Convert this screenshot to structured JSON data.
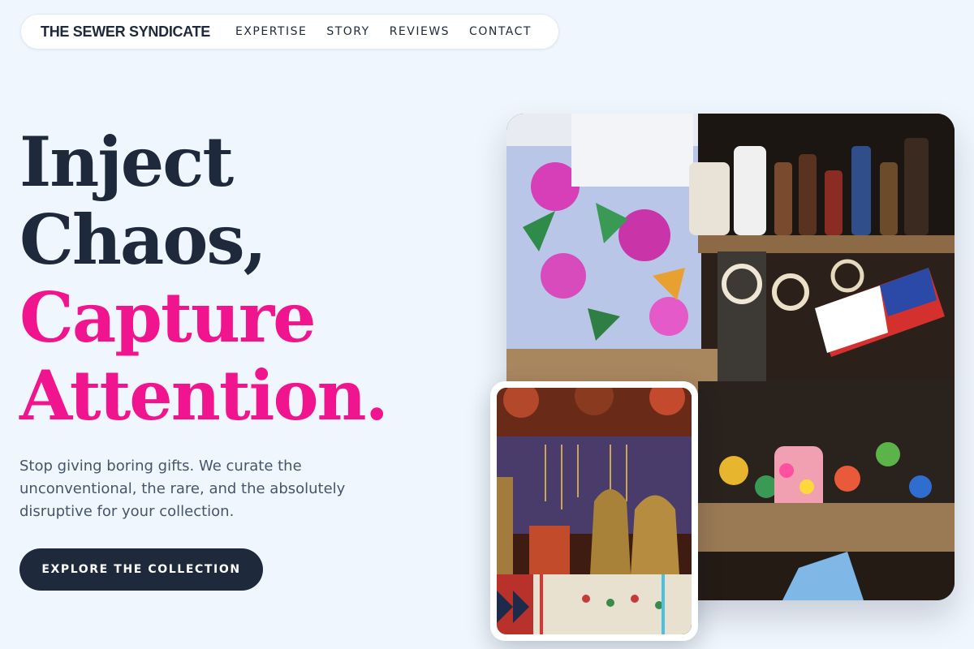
{
  "brand": "THE SEWER SYNDICATE",
  "nav": {
    "links": [
      "EXPERTISE",
      "STORY",
      "REVIEWS",
      "CONTACT"
    ]
  },
  "hero": {
    "line1": "Inject",
    "line2": "Chaos,",
    "line3": "Capture",
    "line4": "Attention.",
    "subtext": "Stop giving boring gifts. We curate the unconventional, the rare, and the absolutely disruptive for your collection.",
    "cta_label": "EXPLORE THE COLLECTION"
  },
  "colors": {
    "accent": "#f0158f",
    "dark": "#1e293b",
    "background": "#eff6fd"
  }
}
